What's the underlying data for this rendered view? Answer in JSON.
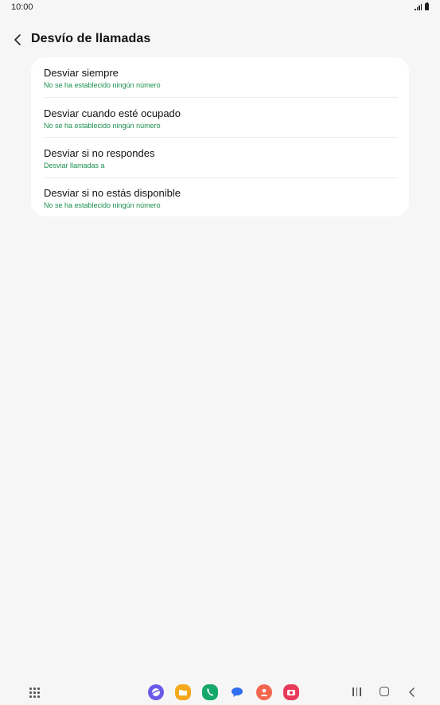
{
  "status_bar": {
    "time": "10:00",
    "icons": [
      "signal-icon",
      "battery-icon"
    ]
  },
  "header": {
    "title": "Desvío de llamadas",
    "back_icon": "chevron-left-icon"
  },
  "forwarding_options": [
    {
      "title": "Desviar siempre",
      "subtitle": "No se ha establecido ningún número"
    },
    {
      "title": "Desviar cuando esté ocupado",
      "subtitle": "No se ha establecido ningún número"
    },
    {
      "title": "Desviar si no respondes",
      "subtitle": "Desviar llamadas a"
    },
    {
      "title": "Desviar si no estás disponible",
      "subtitle": "No se ha establecido ningún número"
    }
  ],
  "navigation_bar": {
    "apps_icon": "apps-grid-icon",
    "dock_apps": [
      {
        "name": "internet-app-icon",
        "color": "#6a5ce8"
      },
      {
        "name": "my-files-app-icon",
        "color": "#f4a81c"
      },
      {
        "name": "phone-app-icon",
        "color": "#14a86b"
      },
      {
        "name": "messages-app-icon",
        "color": "#2f6ff0"
      },
      {
        "name": "contacts-app-icon",
        "color": "#f2684f"
      },
      {
        "name": "camera-app-icon",
        "color": "#e83b5a"
      }
    ],
    "recent_icon": "recent-apps-icon",
    "home_icon": "home-icon",
    "back_icon": "back-icon"
  },
  "colors": {
    "background": "#f6f6f6",
    "card": "#ffffff",
    "subtitle_green": "#1b8f4e"
  }
}
